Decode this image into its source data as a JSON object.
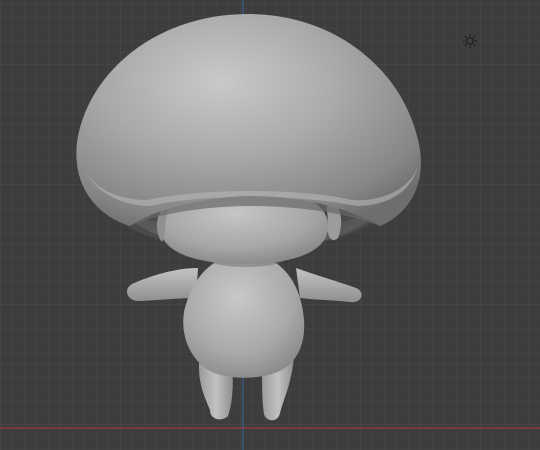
{
  "viewport": {
    "background_color": "#3d3d3d",
    "grid_minor_color": "#454545",
    "grid_major_color": "#4a4a4a",
    "axis_x_color": "#8c3b45",
    "axis_z_color": "#3d5f8a",
    "model_color": "#b3b3b3"
  },
  "scene": {
    "object_name": "mushroom-character",
    "light_icon": "sun-light-icon"
  }
}
